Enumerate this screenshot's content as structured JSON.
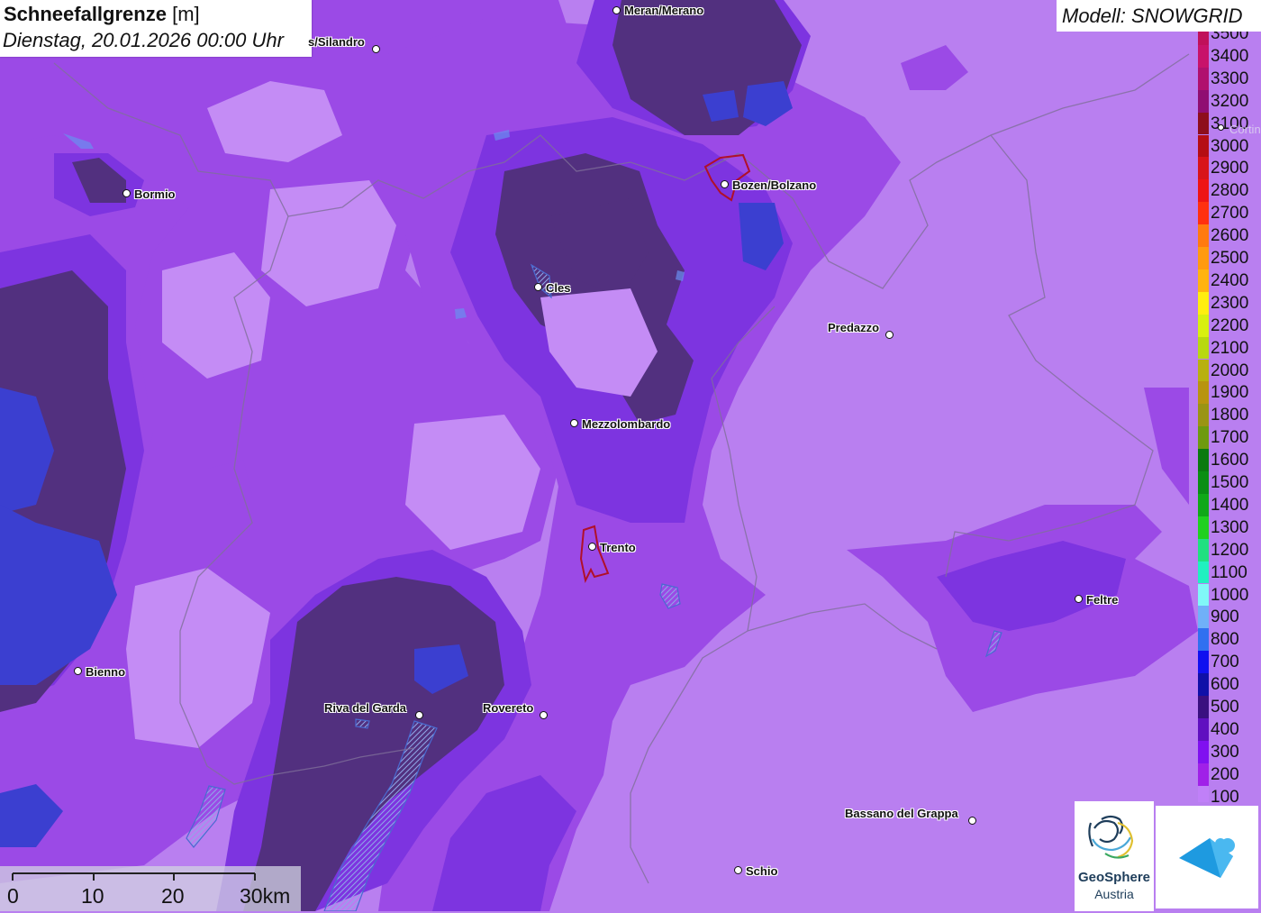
{
  "header": {
    "title_bold": "Schneefallgrenze",
    "title_unit": "[m]",
    "subtitle": "Dienstag, 20.01.2026 00:00 Uhr"
  },
  "model_label": "Modell: SNOWGRID",
  "legend": {
    "entries": [
      {
        "label": "3500",
        "color": "#c0105a"
      },
      {
        "label": "3400",
        "color": "#c8126a"
      },
      {
        "label": "3300",
        "color": "#b0106e"
      },
      {
        "label": "3200",
        "color": "#900e72"
      },
      {
        "label": "3100",
        "color": "#8e0e1c"
      },
      {
        "label": "3000",
        "color": "#b50e14"
      },
      {
        "label": "2900",
        "color": "#d8141a"
      },
      {
        "label": "2800",
        "color": "#ee1414"
      },
      {
        "label": "2700",
        "color": "#ff3010"
      },
      {
        "label": "2600",
        "color": "#ff7a10"
      },
      {
        "label": "2500",
        "color": "#ff9a10"
      },
      {
        "label": "2400",
        "color": "#ffb310"
      },
      {
        "label": "2300",
        "color": "#ffee10"
      },
      {
        "label": "2200",
        "color": "#d8f010"
      },
      {
        "label": "2100",
        "color": "#b8d810"
      },
      {
        "label": "2000",
        "color": "#b8b010"
      },
      {
        "label": "1900",
        "color": "#b89410"
      },
      {
        "label": "1800",
        "color": "#9a9414"
      },
      {
        "label": "1700",
        "color": "#6e9a10"
      },
      {
        "label": "1600",
        "color": "#0a7a10"
      },
      {
        "label": "1500",
        "color": "#0a8e14"
      },
      {
        "label": "1400",
        "color": "#10a818"
      },
      {
        "label": "1300",
        "color": "#20d020"
      },
      {
        "label": "1200",
        "color": "#20e080"
      },
      {
        "label": "1100",
        "color": "#20f0c0"
      },
      {
        "label": "1000",
        "color": "#80f8f8"
      },
      {
        "label": "900",
        "color": "#70b0f8"
      },
      {
        "label": "800",
        "color": "#3070f0"
      },
      {
        "label": "700",
        "color": "#1010f0"
      },
      {
        "label": "600",
        "color": "#1010a8"
      },
      {
        "label": "500",
        "color": "#3a1080"
      },
      {
        "label": "400",
        "color": "#6010c0"
      },
      {
        "label": "300",
        "color": "#8010f0"
      },
      {
        "label": "200",
        "color": "#a020e8"
      },
      {
        "label": "100",
        "color": "#c080f8"
      }
    ]
  },
  "cities": [
    {
      "name": "Meran/Merano"
    },
    {
      "name": "s/Silandro"
    },
    {
      "name": "Bormio"
    },
    {
      "name": "Bozen/Bolzano"
    },
    {
      "name": "Cles"
    },
    {
      "name": "Predazzo"
    },
    {
      "name": "Mezzolombardo"
    },
    {
      "name": "Trento"
    },
    {
      "name": "Feltre"
    },
    {
      "name": "Bienno"
    },
    {
      "name": "Riva del Garda"
    },
    {
      "name": "Rovereto"
    },
    {
      "name": "Bassano del Grappa"
    },
    {
      "name": "Schio"
    },
    {
      "name": "Cortina"
    }
  ],
  "scale_bar": {
    "labels": [
      "0",
      "10",
      "20",
      "30km"
    ]
  },
  "logos": {
    "geosphere_line1": "GeoSphere",
    "geosphere_line2": "Austria"
  },
  "colors": {
    "band_100": "#b97ff0",
    "band_200": "#9b4ae6",
    "band_300": "#7d34e0",
    "band_400": "#5f2db0",
    "band_500": "#4a2a8a",
    "band_600": "#2e25a8",
    "band_700": "#2a40d8"
  }
}
